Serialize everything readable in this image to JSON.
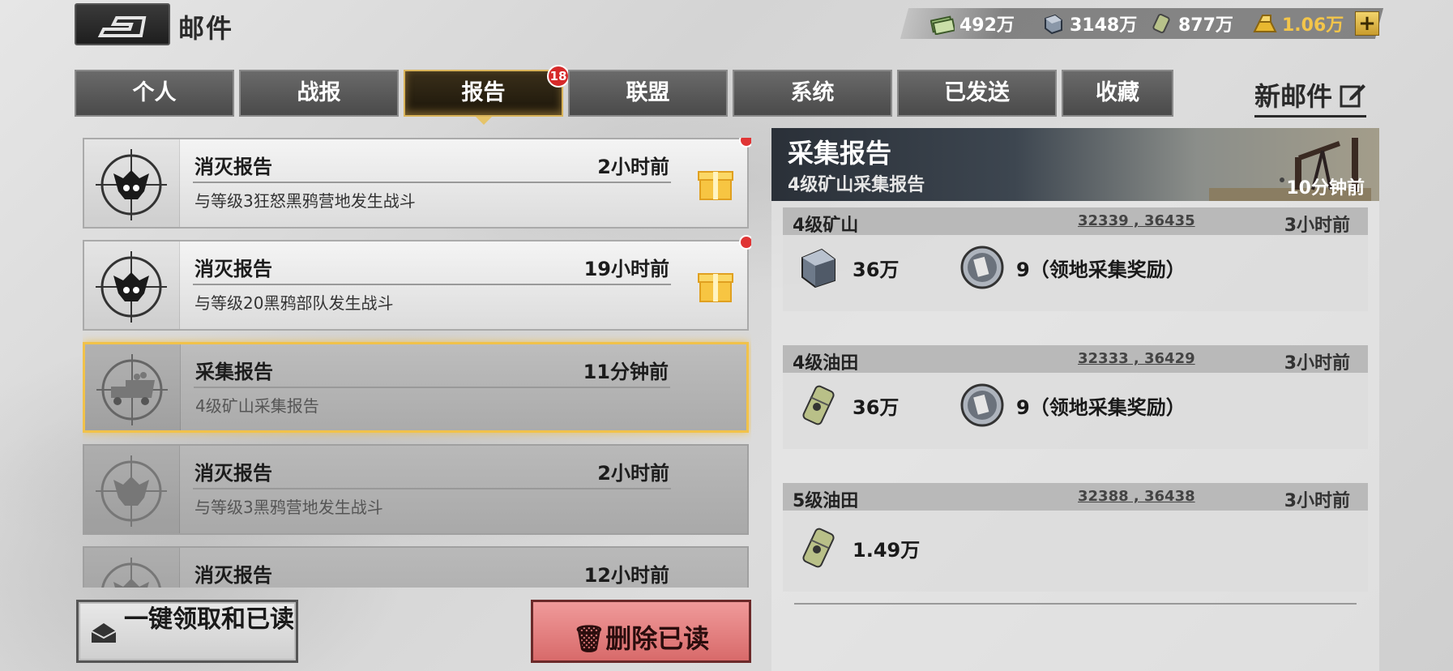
{
  "header": {
    "title": "邮件"
  },
  "resources": [
    {
      "name": "cash",
      "value": "492万"
    },
    {
      "name": "steel",
      "value": "3148万"
    },
    {
      "name": "oil",
      "value": "877万"
    },
    {
      "name": "gold",
      "value": "1.06万"
    }
  ],
  "tabs": [
    {
      "label": "个人"
    },
    {
      "label": "战报"
    },
    {
      "label": "报告",
      "badge": "18"
    },
    {
      "label": "联盟"
    },
    {
      "label": "系统"
    },
    {
      "label": "已发送"
    },
    {
      "label": "收藏"
    }
  ],
  "new_mail": "新邮件",
  "mails": [
    {
      "title": "消灭报告",
      "time": "2小时前",
      "sub": "与等级3狂怒黑鸦营地发生战斗"
    },
    {
      "title": "消灭报告",
      "time": "19小时前",
      "sub": "与等级20黑鸦部队发生战斗"
    },
    {
      "title": "采集报告",
      "time": "11分钟前",
      "sub": "4级矿山采集报告"
    },
    {
      "title": "消灭报告",
      "time": "2小时前",
      "sub": "与等级3黑鸦营地发生战斗"
    },
    {
      "title": "消灭报告",
      "time": "12小时前",
      "sub": ""
    }
  ],
  "buttons": {
    "collect": "一键领取和已读",
    "delete": "删除已读"
  },
  "detail": {
    "title": "采集报告",
    "subtitle": "4级矿山采集报告",
    "time": "10分钟前",
    "entries": [
      {
        "name": "4级矿山",
        "coords": "32339 , 36435",
        "time": "3小时前",
        "resource": "36万",
        "bonus": "9（领地采集奖励）"
      },
      {
        "name": "4级油田",
        "coords": "32333 , 36429",
        "time": "3小时前",
        "resource": "36万",
        "bonus": "9（领地采集奖励）"
      },
      {
        "name": "5级油田",
        "coords": "32388 , 36438",
        "time": "3小时前",
        "resource": "1.49万"
      }
    ]
  }
}
